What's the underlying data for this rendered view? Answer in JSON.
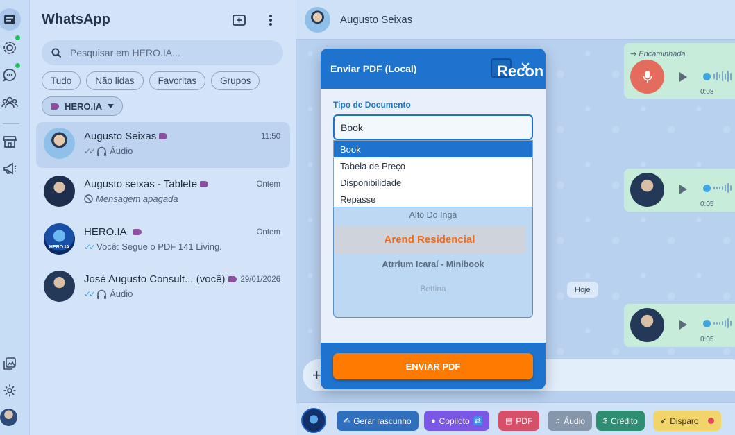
{
  "app": {
    "title": "WhatsApp"
  },
  "search": {
    "placeholder": "Pesquisar em HERO.IA..."
  },
  "filters": [
    "Tudo",
    "Não lidas",
    "Favoritas",
    "Grupos"
  ],
  "label_filter": "HERO.IA",
  "chats": [
    {
      "name": "Augusto Seixas",
      "time": "11:50",
      "preview": "Áudio",
      "selected": true
    },
    {
      "name": "Augusto seixas - Tablete",
      "time": "Ontem",
      "preview": "Mensagem apagada"
    },
    {
      "name": "HERO.IA",
      "time": "Ontem",
      "preview": "Você: Segue o PDF 141 Living."
    },
    {
      "name": "José Augusto  Consult...",
      "you": "(você)",
      "time": "29/01/2026",
      "preview": "Áudio"
    }
  ],
  "avatar_texts": {
    "hero": "HERO.IA"
  },
  "conversation": {
    "contact": "Augusto Seixas",
    "forwarded": "Encaminhada",
    "durations": [
      "0:08",
      "0:05",
      "0:05"
    ],
    "date_chip": "Hoje"
  },
  "modal": {
    "title": "Enviar PDF (Local)",
    "overflow_text": "Recon",
    "field_label": "Tipo de Documento",
    "selected": "Book",
    "options": [
      "Book",
      "Tabela de Preço",
      "Disponibilidade",
      "Repasse"
    ],
    "list": [
      "Alto Do Ingá",
      "Arend Residencial",
      "Atrrium Icaraí - Minibook",
      "Bettina"
    ],
    "send_label": "ENVIAR PDF"
  },
  "toolbar": {
    "buttons": [
      {
        "label": "Gerar rascunho",
        "color": "#2f6fbd"
      },
      {
        "label": "Copiloto",
        "color": "#7b57e6"
      },
      {
        "label": "PDF",
        "color": "#d6506a"
      },
      {
        "label": "Áudio",
        "color": "#8797ab"
      },
      {
        "label": "Crédito",
        "color": "#2f8d72"
      },
      {
        "label": "Disparo",
        "color": "#f1d46a"
      }
    ]
  },
  "colors": {
    "accent": "#1e73cf",
    "send": "#ff7b00",
    "unread_dot": "#25c15e",
    "label_tag": "#8b4fa0"
  }
}
